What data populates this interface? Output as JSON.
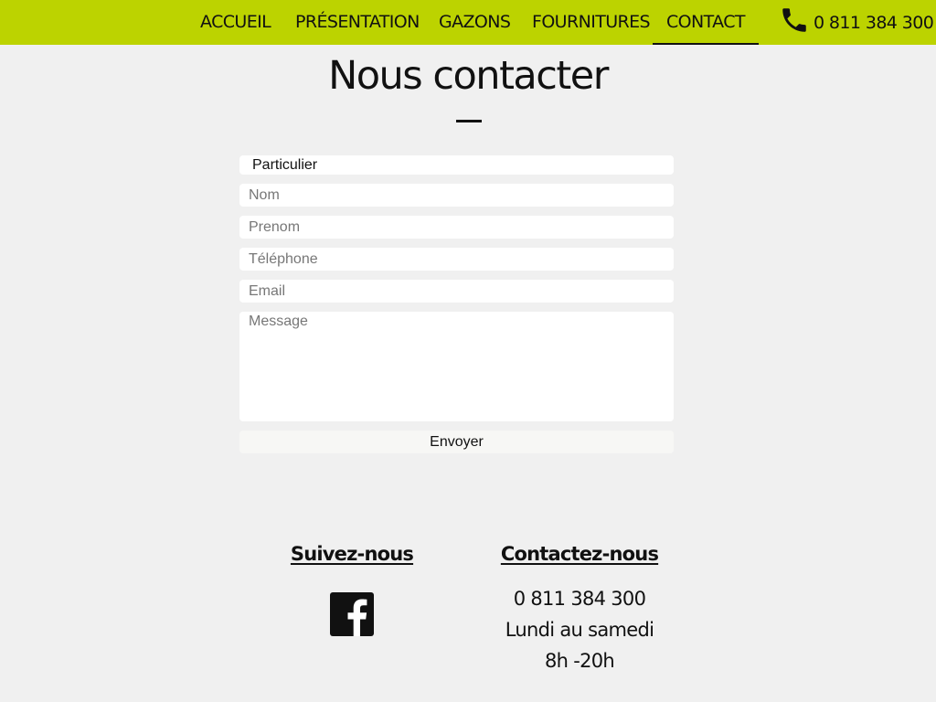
{
  "nav": {
    "items": [
      {
        "label": "ACCUEIL"
      },
      {
        "label": "PRÉSENTATION"
      },
      {
        "label": "GAZONS"
      },
      {
        "label": "FOURNITURES"
      },
      {
        "label": "CONTACT",
        "active": true
      }
    ],
    "phone": "0 811 384 300"
  },
  "page": {
    "title": "Nous contacter"
  },
  "form": {
    "type_selected": "Particulier",
    "nom_placeholder": "Nom",
    "prenom_placeholder": "Prenom",
    "telephone_placeholder": "Téléphone",
    "email_placeholder": "Email",
    "message_placeholder": "Message",
    "submit_label": "Envoyer"
  },
  "footer": {
    "follow_heading": "Suivez-nous",
    "contact_heading": "Contactez-nous",
    "phone": "0 811 384 300",
    "days": "Lundi au samedi",
    "hours": "8h -20h"
  },
  "colors": {
    "header_bg": "#bcd300",
    "page_bg": "#f0f0f0",
    "text": "#111111"
  },
  "icons": {
    "phone": "phone-icon",
    "facebook": "facebook-icon"
  }
}
